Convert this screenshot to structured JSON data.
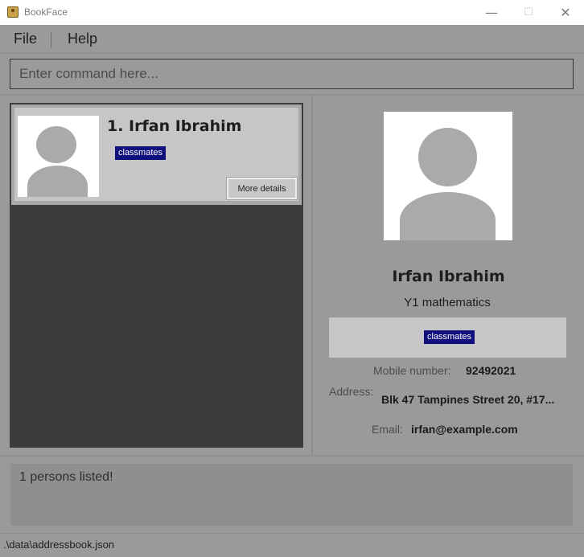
{
  "window": {
    "title": "BookFace",
    "minimize_glyph": "—",
    "maximize_glyph": "☐",
    "close_glyph": "✕"
  },
  "menu": {
    "file": "File",
    "help": "Help"
  },
  "command_box": {
    "placeholder": "Enter command here...",
    "value": ""
  },
  "person_list": {
    "items": [
      {
        "index_name": "1. Irfan Ibrahim",
        "tags": [
          "classmates"
        ],
        "more_details_label": "More details"
      }
    ]
  },
  "details": {
    "name": "Irfan Ibrahim",
    "subtitle": "Y1 mathematics",
    "tags": [
      "classmates"
    ],
    "mobile_label": "Mobile number:",
    "mobile_value": "92492021",
    "address_label": "Address:",
    "address_value": "Blk 47 Tampines Street 20, #17...",
    "email_label": "Email:",
    "email_value": "irfan@example.com"
  },
  "result_display": {
    "text": "1 persons listed!"
  },
  "status_bar": {
    "path": ".\\data\\addressbook.json"
  },
  "colors": {
    "tag_background": "#0f0f7d",
    "theme_gray": "#9a9a9a",
    "list_panel_background": "#3c3c3c"
  },
  "icons": {
    "app": "bookface-app-icon",
    "placeholder_photo": "person-silhouette-icon"
  }
}
